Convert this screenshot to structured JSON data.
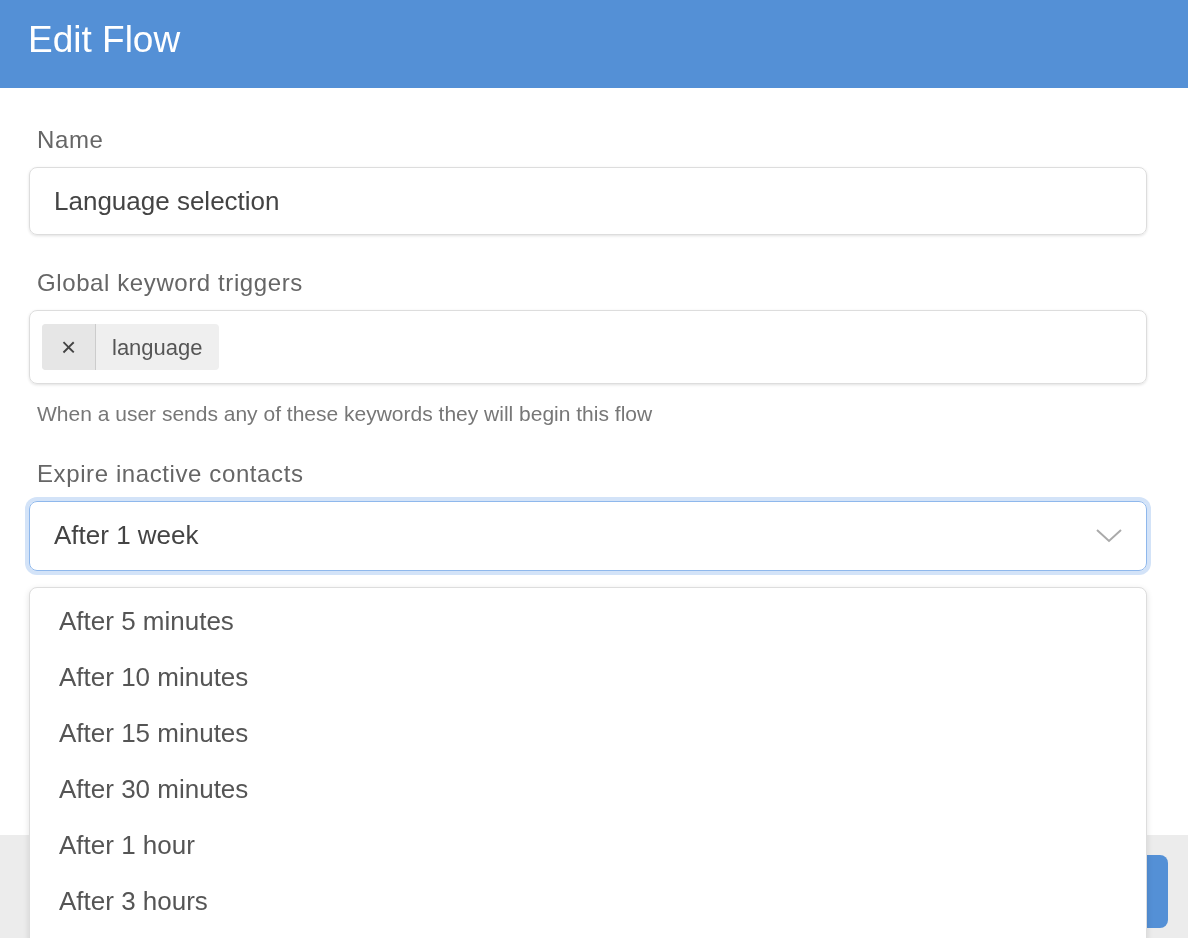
{
  "header": {
    "title": "Edit Flow"
  },
  "name_field": {
    "label": "Name",
    "value": "Language selection"
  },
  "keyword_field": {
    "label": "Global keyword triggers",
    "tags": [
      {
        "remove": "×",
        "text": "language"
      }
    ],
    "help": "When a user sends any of these keywords they will begin this flow"
  },
  "expire_field": {
    "label": "Expire inactive contacts",
    "value": "After 1 week",
    "open": true,
    "options": [
      {
        "label": "After 5 minutes",
        "selected": false
      },
      {
        "label": "After 10 minutes",
        "selected": false
      },
      {
        "label": "After 15 minutes",
        "selected": false
      },
      {
        "label": "After 30 minutes",
        "selected": false
      },
      {
        "label": "After 1 hour",
        "selected": false
      },
      {
        "label": "After 3 hours",
        "selected": false
      }
    ]
  }
}
